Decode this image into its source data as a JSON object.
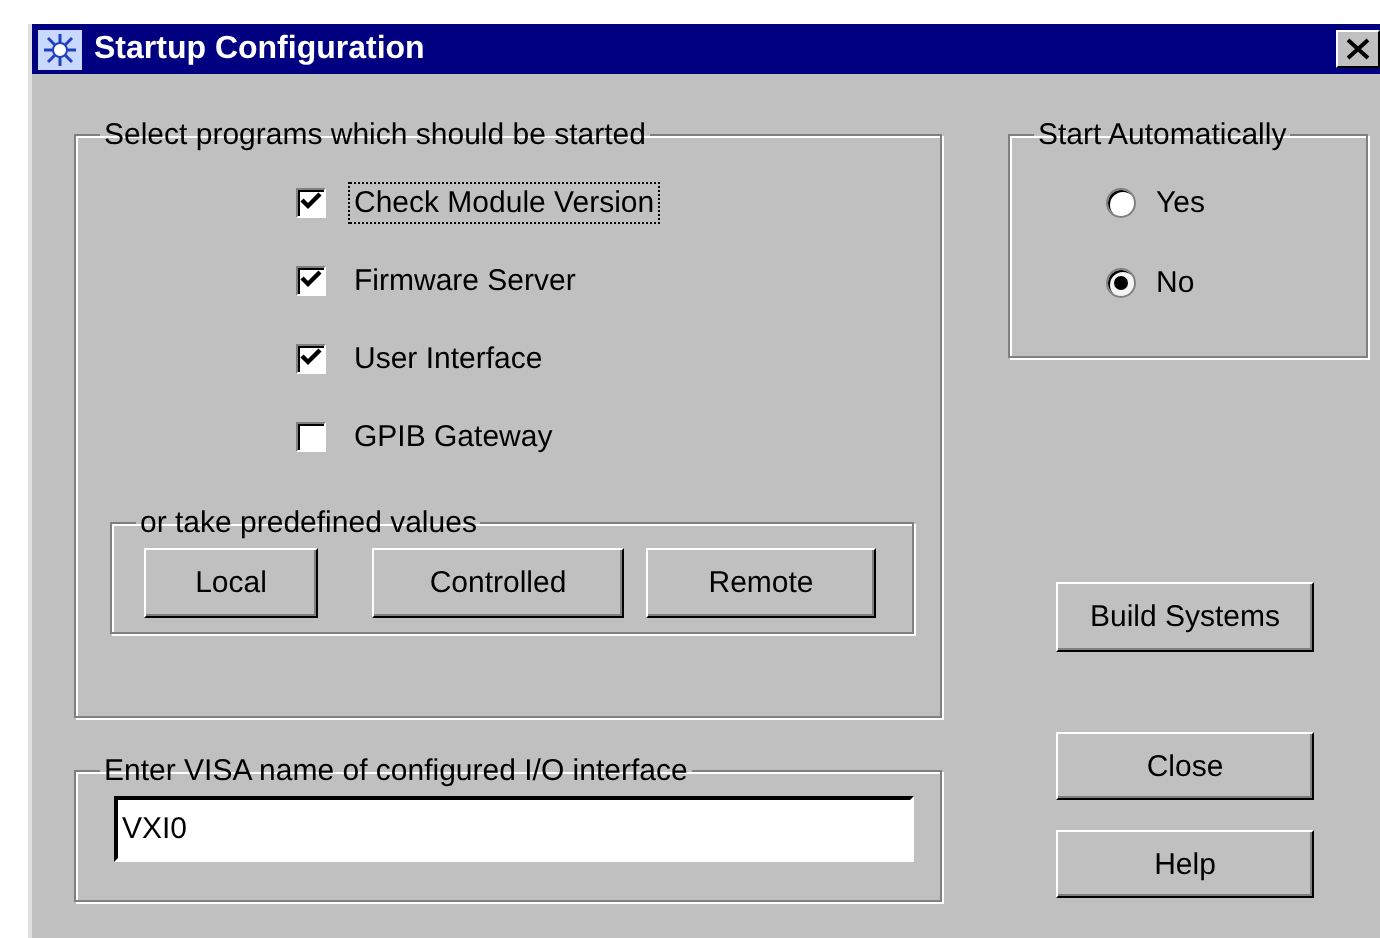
{
  "window": {
    "title": "Startup Configuration"
  },
  "programs": {
    "legend": "Select programs which should be started",
    "items": [
      {
        "label": "Check Module Version",
        "checked": true,
        "focused": true
      },
      {
        "label": "Firmware Server",
        "checked": true,
        "focused": false
      },
      {
        "label": "User Interface",
        "checked": true,
        "focused": false
      },
      {
        "label": "GPIB Gateway",
        "checked": false,
        "focused": false
      }
    ],
    "predefined": {
      "legend": "or take predefined values",
      "buttons": [
        "Local",
        "Controlled",
        "Remote"
      ]
    }
  },
  "start_automatically": {
    "legend": "Start Automatically",
    "options": [
      {
        "label": "Yes",
        "selected": false
      },
      {
        "label": "No",
        "selected": true
      }
    ]
  },
  "visa": {
    "legend": "Enter VISA name of configured I/O interface",
    "value": "VXI0"
  },
  "buttons": [
    "Build Systems",
    "Close",
    "Help"
  ]
}
